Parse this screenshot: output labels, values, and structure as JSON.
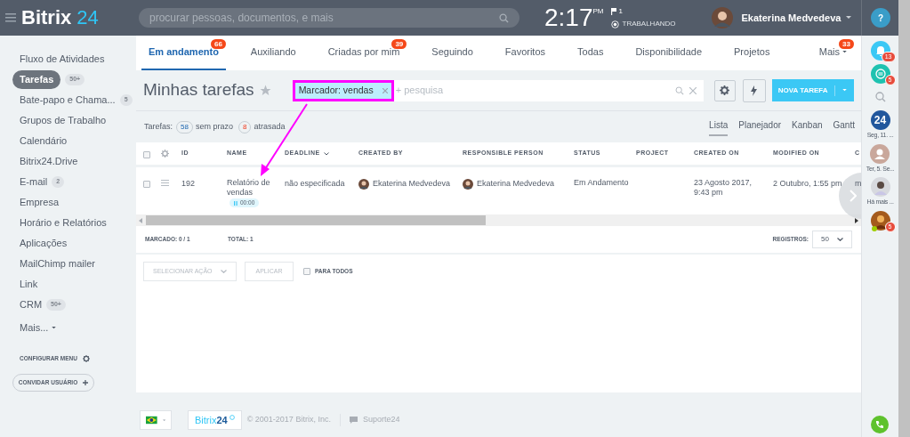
{
  "header": {
    "app_name": "Bitrix",
    "app_number": "24",
    "search_placeholder": "procurar pessoas, documentos, e mais",
    "time": "2:17",
    "ampm": "PM",
    "flag_count": "1",
    "work_status": "TRABALHANDO",
    "user_name": "Ekaterina Medvedeva",
    "help": "?"
  },
  "sidebar": {
    "items": [
      {
        "label": "Fluxo de Atividades",
        "selected": false
      },
      {
        "label": "Tarefas",
        "selected": true,
        "counter": "50+"
      },
      {
        "label": "Bate-papo e Chama...",
        "selected": false,
        "counter": "5"
      },
      {
        "label": "Grupos de Trabalho",
        "selected": false
      },
      {
        "label": "Calendário",
        "selected": false
      },
      {
        "label": "Bitrix24.Drive",
        "selected": false
      },
      {
        "label": "E-mail",
        "selected": false,
        "counter": "2"
      },
      {
        "label": "Empresa",
        "selected": false
      },
      {
        "label": "Horário e Relatórios",
        "selected": false
      },
      {
        "label": "Aplicações",
        "selected": false
      },
      {
        "label": "MailChimp mailer",
        "selected": false
      },
      {
        "label": "Link",
        "selected": false
      },
      {
        "label": "CRM",
        "selected": false,
        "counter": "50+"
      }
    ],
    "more": "Mais...",
    "configure": "CONFIGURAR MENU",
    "invite": "CONVIDAR USUÁRIO"
  },
  "tabs": [
    {
      "label": "Em andamento",
      "selected": true,
      "counter": "66"
    },
    {
      "label": "Auxiliando",
      "selected": false
    },
    {
      "label": "Criadas por mim",
      "selected": false,
      "counter": "39"
    },
    {
      "label": "Seguindo",
      "selected": false
    },
    {
      "label": "Favoritos",
      "selected": false
    },
    {
      "label": "Todas",
      "selected": false
    },
    {
      "label": "Disponibilidade",
      "selected": false
    },
    {
      "label": "Projetos",
      "selected": false
    },
    {
      "label": "Mais",
      "selected": false,
      "counter": "33",
      "dropdown": true
    }
  ],
  "page": {
    "title": "Minhas tarefas",
    "filter_tag": "Marcador: vendas",
    "search_placeholder": "+ pesquisa",
    "new_task_button": "NOVA TAREFA"
  },
  "stats": {
    "label": "Tarefas:",
    "items": [
      {
        "count": "58",
        "label": "sem prazo",
        "kind": "neutral"
      },
      {
        "count": "8",
        "label": "atrasada",
        "kind": "alert"
      }
    ]
  },
  "views": [
    {
      "label": "Lista",
      "selected": true
    },
    {
      "label": "Planejador",
      "selected": false
    },
    {
      "label": "Kanban",
      "selected": false
    },
    {
      "label": "Gantt",
      "selected": false
    }
  ],
  "table": {
    "select_all_checked": false,
    "columns": [
      "ID",
      "NAME",
      "DEADLINE",
      "CREATED BY",
      "RESPONSIBLE PERSON",
      "STATUS",
      "PROJECT",
      "CREATED ON",
      "MODIFIED ON",
      "C"
    ],
    "rows": [
      {
        "checked": false,
        "id": "192",
        "name": "Relatório de vendas",
        "timer": "00:00",
        "deadline": "não especificada",
        "created_by": "Ekaterina Medvedeva",
        "responsible": "Ekaterina Medvedeva",
        "status": "Em Andamento",
        "created_on": "23 Agosto 2017, 9:43 pm",
        "modified_on": "2 Outubro, 1:55 pm",
        "column_10": "m"
      }
    ]
  },
  "table_footer": {
    "marked": "MARCADO: 0 / 1",
    "total": "TOTAL: 1",
    "records_label": "REGISTROS:",
    "records_value": "50"
  },
  "actions": {
    "action_select": "SELECIONAR AÇÃO",
    "apply": "APLICAR",
    "for_all": "PARA TODOS",
    "for_all_checked": false
  },
  "page_footer": {
    "logo": "Bitrix",
    "logo_number": "24",
    "copyright": "© 2001-2017 Bitrix, Inc.",
    "support": "Suporte24"
  },
  "right_panel": {
    "items": [
      {
        "kind": "bell",
        "counter": "13"
      },
      {
        "kind": "chat",
        "counter": "5"
      },
      {
        "kind": "search"
      },
      {
        "kind": "logo",
        "logo_text": "24",
        "caption": "Seg, 11. ..."
      },
      {
        "kind": "person",
        "caption": "Ter, 5. Se..."
      },
      {
        "kind": "avatar",
        "caption": "Há mais ..."
      },
      {
        "kind": "avatar",
        "counter": "5",
        "online": true
      }
    ]
  }
}
